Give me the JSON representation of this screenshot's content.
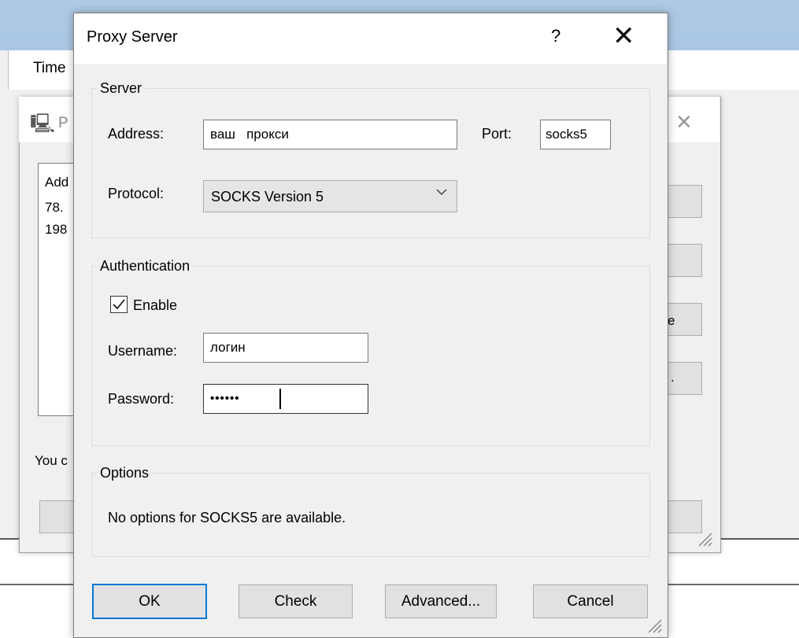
{
  "background_window": {
    "column_header": "Time"
  },
  "middle_dialog": {
    "title_fragment": "P",
    "list_header_fragment": "Add",
    "list_items": [
      "78.",
      "198"
    ],
    "footer_text_fragment": "You c",
    "side_button_labels": [
      "",
      "",
      "e",
      "."
    ]
  },
  "proxy_dialog": {
    "title": "Proxy Server",
    "help_label": "?",
    "close_label": "✕",
    "server_group": {
      "legend": "Server",
      "address_label": "Address:",
      "address_value": "ваш   прокси",
      "port_label": "Port:",
      "port_value": "socks5",
      "protocol_label": "Protocol:",
      "protocol_selected": "SOCKS Version 5"
    },
    "auth_group": {
      "legend": "Authentication",
      "enable_label": "Enable",
      "enable_checked": true,
      "username_label": "Username:",
      "username_value": "логин",
      "password_label": "Password:",
      "password_value": "••••••"
    },
    "options_group": {
      "legend": "Options",
      "text": "No options for SOCKS5 are available."
    },
    "buttons": {
      "ok": "OK",
      "check": "Check",
      "advanced": "Advanced...",
      "cancel": "Cancel"
    }
  },
  "colors": {
    "accent": "#0078d7",
    "dialog_bg": "#f0f0f0",
    "titlebar_bg": "#ffffff",
    "bg_titlebar": "#aecae6"
  }
}
